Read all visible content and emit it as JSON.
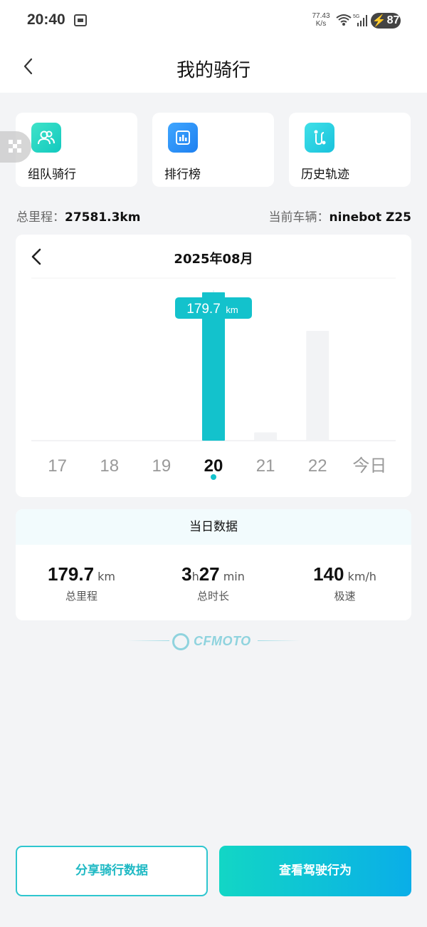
{
  "status_bar": {
    "time": "20:40",
    "net_speed_value": "77.43",
    "net_speed_unit": "K/s",
    "network": "5G",
    "battery": "87"
  },
  "header": {
    "title": "我的骑行",
    "back_icon": "chevron-left-icon"
  },
  "quick_actions": [
    {
      "label": "组队骑行",
      "icon": "team-riding-icon",
      "color_from": "#3fe3c8",
      "color_to": "#12c9bf"
    },
    {
      "label": "排行榜",
      "icon": "leaderboard-icon",
      "color_from": "#3fa6ff",
      "color_to": "#1e80f0"
    },
    {
      "label": "历史轨迹",
      "icon": "route-history-icon",
      "color_from": "#3fe0e8",
      "color_to": "#19c2dc"
    }
  ],
  "summary": {
    "total_label": "总里程：",
    "total_value": "27581.3km",
    "vehicle_label": "当前车辆：",
    "vehicle_value": "ninebot Z25"
  },
  "chart": {
    "month_label": "2025年08月",
    "prev_icon": "chevron-left-icon",
    "selected_index": 3,
    "tooltip_value": "179.7",
    "tooltip_unit": "km",
    "accent_color": "#13c2cc",
    "inactive_bar_color": "#f2f3f5"
  },
  "chart_data": {
    "type": "bar",
    "categories": [
      "17",
      "18",
      "19",
      "20",
      "21",
      "22",
      "今日"
    ],
    "values": [
      0,
      0,
      0,
      179.7,
      10,
      133,
      0
    ],
    "ylim": [
      0,
      190
    ],
    "grid": false,
    "selected_category": "20"
  },
  "daily": {
    "title": "当日数据",
    "distance_value": "179.7",
    "distance_unit": "km",
    "distance_label": "总里程",
    "hours_value": "3",
    "hours_unit": "h",
    "minutes_value": "27",
    "minutes_unit": "min",
    "duration_label": "总时长",
    "speed_value": "140",
    "speed_unit": "km/h",
    "speed_label": "极速"
  },
  "brand": {
    "name": "CFMOTO"
  },
  "buttons": {
    "share_label": "分享骑行数据",
    "behavior_label": "查看驾驶行为"
  }
}
